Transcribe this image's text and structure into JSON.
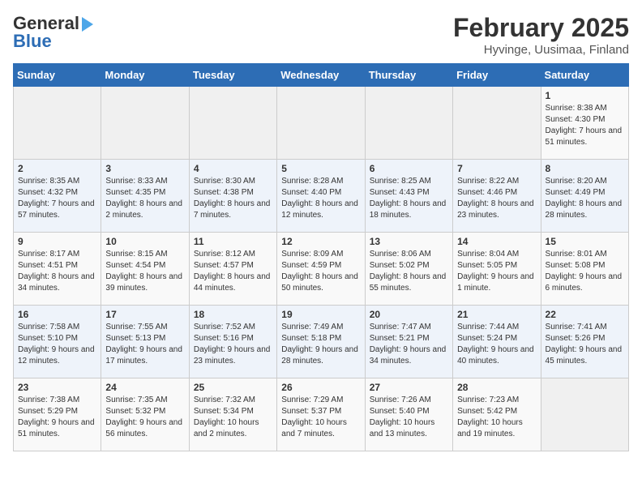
{
  "header": {
    "logo_line1": "General",
    "logo_line2": "Blue",
    "title": "February 2025",
    "subtitle": "Hyvinge, Uusimaa, Finland"
  },
  "weekdays": [
    "Sunday",
    "Monday",
    "Tuesday",
    "Wednesday",
    "Thursday",
    "Friday",
    "Saturday"
  ],
  "weeks": [
    [
      {
        "day": "",
        "info": ""
      },
      {
        "day": "",
        "info": ""
      },
      {
        "day": "",
        "info": ""
      },
      {
        "day": "",
        "info": ""
      },
      {
        "day": "",
        "info": ""
      },
      {
        "day": "",
        "info": ""
      },
      {
        "day": "1",
        "info": "Sunrise: 8:38 AM\nSunset: 4:30 PM\nDaylight: 7 hours and 51 minutes."
      }
    ],
    [
      {
        "day": "2",
        "info": "Sunrise: 8:35 AM\nSunset: 4:32 PM\nDaylight: 7 hours and 57 minutes."
      },
      {
        "day": "3",
        "info": "Sunrise: 8:33 AM\nSunset: 4:35 PM\nDaylight: 8 hours and 2 minutes."
      },
      {
        "day": "4",
        "info": "Sunrise: 8:30 AM\nSunset: 4:38 PM\nDaylight: 8 hours and 7 minutes."
      },
      {
        "day": "5",
        "info": "Sunrise: 8:28 AM\nSunset: 4:40 PM\nDaylight: 8 hours and 12 minutes."
      },
      {
        "day": "6",
        "info": "Sunrise: 8:25 AM\nSunset: 4:43 PM\nDaylight: 8 hours and 18 minutes."
      },
      {
        "day": "7",
        "info": "Sunrise: 8:22 AM\nSunset: 4:46 PM\nDaylight: 8 hours and 23 minutes."
      },
      {
        "day": "8",
        "info": "Sunrise: 8:20 AM\nSunset: 4:49 PM\nDaylight: 8 hours and 28 minutes."
      }
    ],
    [
      {
        "day": "9",
        "info": "Sunrise: 8:17 AM\nSunset: 4:51 PM\nDaylight: 8 hours and 34 minutes."
      },
      {
        "day": "10",
        "info": "Sunrise: 8:15 AM\nSunset: 4:54 PM\nDaylight: 8 hours and 39 minutes."
      },
      {
        "day": "11",
        "info": "Sunrise: 8:12 AM\nSunset: 4:57 PM\nDaylight: 8 hours and 44 minutes."
      },
      {
        "day": "12",
        "info": "Sunrise: 8:09 AM\nSunset: 4:59 PM\nDaylight: 8 hours and 50 minutes."
      },
      {
        "day": "13",
        "info": "Sunrise: 8:06 AM\nSunset: 5:02 PM\nDaylight: 8 hours and 55 minutes."
      },
      {
        "day": "14",
        "info": "Sunrise: 8:04 AM\nSunset: 5:05 PM\nDaylight: 9 hours and 1 minute."
      },
      {
        "day": "15",
        "info": "Sunrise: 8:01 AM\nSunset: 5:08 PM\nDaylight: 9 hours and 6 minutes."
      }
    ],
    [
      {
        "day": "16",
        "info": "Sunrise: 7:58 AM\nSunset: 5:10 PM\nDaylight: 9 hours and 12 minutes."
      },
      {
        "day": "17",
        "info": "Sunrise: 7:55 AM\nSunset: 5:13 PM\nDaylight: 9 hours and 17 minutes."
      },
      {
        "day": "18",
        "info": "Sunrise: 7:52 AM\nSunset: 5:16 PM\nDaylight: 9 hours and 23 minutes."
      },
      {
        "day": "19",
        "info": "Sunrise: 7:49 AM\nSunset: 5:18 PM\nDaylight: 9 hours and 28 minutes."
      },
      {
        "day": "20",
        "info": "Sunrise: 7:47 AM\nSunset: 5:21 PM\nDaylight: 9 hours and 34 minutes."
      },
      {
        "day": "21",
        "info": "Sunrise: 7:44 AM\nSunset: 5:24 PM\nDaylight: 9 hours and 40 minutes."
      },
      {
        "day": "22",
        "info": "Sunrise: 7:41 AM\nSunset: 5:26 PM\nDaylight: 9 hours and 45 minutes."
      }
    ],
    [
      {
        "day": "23",
        "info": "Sunrise: 7:38 AM\nSunset: 5:29 PM\nDaylight: 9 hours and 51 minutes."
      },
      {
        "day": "24",
        "info": "Sunrise: 7:35 AM\nSunset: 5:32 PM\nDaylight: 9 hours and 56 minutes."
      },
      {
        "day": "25",
        "info": "Sunrise: 7:32 AM\nSunset: 5:34 PM\nDaylight: 10 hours and 2 minutes."
      },
      {
        "day": "26",
        "info": "Sunrise: 7:29 AM\nSunset: 5:37 PM\nDaylight: 10 hours and 7 minutes."
      },
      {
        "day": "27",
        "info": "Sunrise: 7:26 AM\nSunset: 5:40 PM\nDaylight: 10 hours and 13 minutes."
      },
      {
        "day": "28",
        "info": "Sunrise: 7:23 AM\nSunset: 5:42 PM\nDaylight: 10 hours and 19 minutes."
      },
      {
        "day": "",
        "info": ""
      }
    ]
  ]
}
